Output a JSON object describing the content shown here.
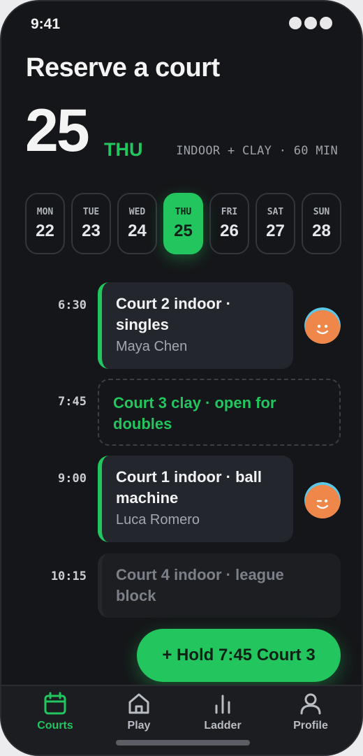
{
  "status_bar": {
    "time": "9:41"
  },
  "header": {
    "title": "Reserve a court",
    "day_number": "25",
    "day_of_week": "THU",
    "meta": "INDOOR + CLAY · 60 MIN"
  },
  "days": [
    {
      "dow": "MON",
      "num": "22",
      "selected": false
    },
    {
      "dow": "TUE",
      "num": "23",
      "selected": false
    },
    {
      "dow": "WED",
      "num": "24",
      "selected": false
    },
    {
      "dow": "THU",
      "num": "25",
      "selected": true
    },
    {
      "dow": "FRI",
      "num": "26",
      "selected": false
    },
    {
      "dow": "SAT",
      "num": "27",
      "selected": false
    },
    {
      "dow": "SUN",
      "num": "28",
      "selected": false
    }
  ],
  "slots": [
    {
      "time": "6:30",
      "title_line1": "Court 2 indoor ·",
      "title_line2": "singles",
      "player": "Maya Chen",
      "status": "booked"
    },
    {
      "time": "7:45",
      "title_line1": "Court 3 clay · open for",
      "title_line2": "doubles",
      "status": "open"
    },
    {
      "time": "9:00",
      "title_line1": "Court 1 indoor · ball",
      "title_line2": "machine",
      "player": "Luca Romero",
      "status": "booked"
    },
    {
      "time": "10:15",
      "title_line1": "Court 4 indoor · league",
      "title_line2": "block",
      "status": "blocked"
    }
  ],
  "cta": {
    "icon": "plus-icon",
    "label": "+ Hold 7:45 Court 3"
  },
  "nav": [
    {
      "label": "Courts",
      "icon": "calendar-icon",
      "active": true
    },
    {
      "label": "Play",
      "icon": "home-icon",
      "active": false
    },
    {
      "label": "Ladder",
      "icon": "bar-chart-icon",
      "active": false
    },
    {
      "label": "Profile",
      "icon": "user-icon",
      "active": false
    }
  ],
  "colors": {
    "accent": "#22c55e",
    "background": "#151619",
    "card": "#23262c",
    "avatar_bg": "#f0874a",
    "avatar_ring": "#5bc8e8"
  }
}
